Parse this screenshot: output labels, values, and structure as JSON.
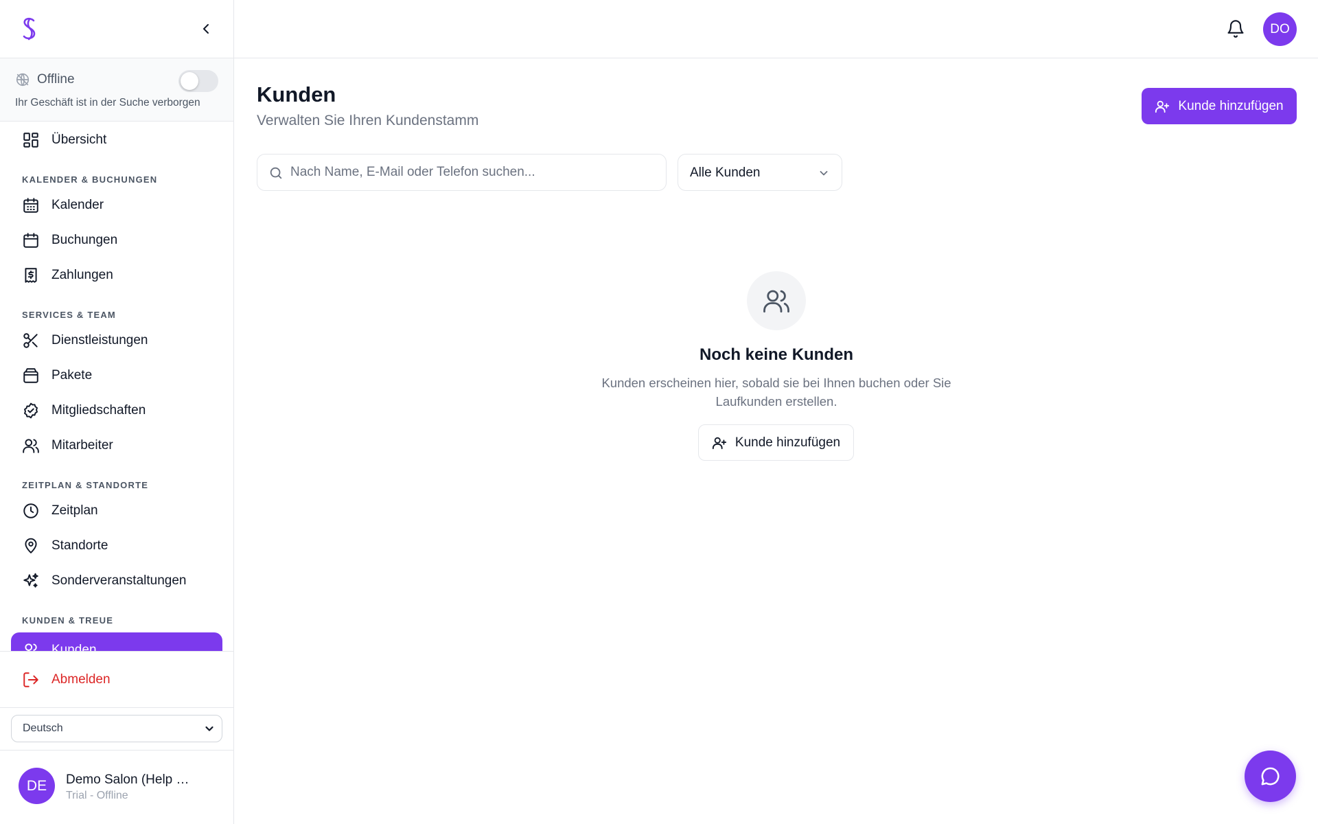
{
  "sidebar": {
    "status": {
      "label": "Offline",
      "subtitle": "Ihr Geschäft ist in der Suche verborgen",
      "toggle_on": false
    },
    "items": {
      "overview": "Übersicht",
      "calendar": "Kalender",
      "bookings": "Buchungen",
      "payments": "Zahlungen",
      "services": "Dienstleistungen",
      "packages": "Pakete",
      "memberships": "Mitgliedschaften",
      "staff": "Mitarbeiter",
      "schedule": "Zeitplan",
      "locations": "Standorte",
      "special_events": "Sonderveranstaltungen",
      "customers": "Kunden"
    },
    "sections": {
      "calendar_bookings": "KALENDER & BUCHUNGEN",
      "services_team": "SERVICES & TEAM",
      "schedule_locations": "ZEITPLAN & STANDORTE",
      "customers_loyalty": "KUNDEN & TREUE"
    },
    "active_item": "customers",
    "logout": "Abmelden",
    "language": "Deutsch",
    "account": {
      "initials": "DE",
      "name": "Demo Salon (Help …",
      "subtitle": "Trial - Offline"
    }
  },
  "topbar": {
    "user_initials": "DO",
    "icons": [
      "bell-icon"
    ]
  },
  "main": {
    "title": "Kunden",
    "subtitle": "Verwalten Sie Ihren Kundenstamm",
    "add_button": "Kunde hinzufügen",
    "search": {
      "placeholder": "Nach Name, E-Mail oder Telefon suchen...",
      "value": ""
    },
    "filter": {
      "selected": "Alle Kunden"
    },
    "empty_state": {
      "title": "Noch keine Kunden",
      "text": "Kunden erscheinen hier, sobald sie bei Ihnen buchen oder Sie Laufkunden erstellen.",
      "button": "Kunde hinzufügen"
    }
  },
  "colors": {
    "accent": "#7c3aed",
    "danger": "#dc2626",
    "muted_text": "#6b7280",
    "border": "#e5e7eb"
  }
}
